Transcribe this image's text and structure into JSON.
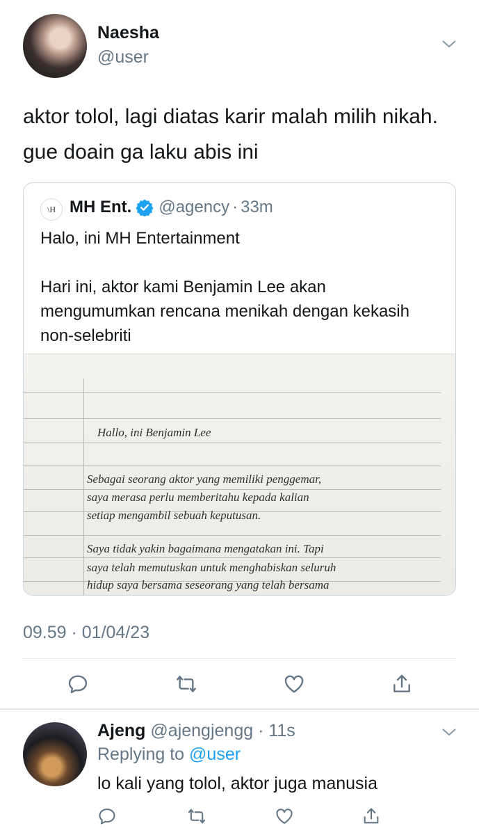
{
  "tweet": {
    "author_name": "Naesha",
    "author_handle": "@user",
    "text": "aktor tolol, lagi diatas karir malah milih nikah. gue doain ga laku abis ini",
    "timestamp": "09.59 · 01/04/23"
  },
  "quote": {
    "logo_text": "\\H",
    "author_name": "MH Ent.",
    "author_handle": "@agency",
    "separator": "·",
    "time": "33m",
    "body": "Halo, ini MH Entertainment\n\nHari ini, aktor kami Benjamin Lee akan mengumumkan rencana menikah dengan kekasih non-selebriti",
    "letter_lines": [
      "Hallo, ini Benjamin Lee",
      "Sebagai seorang aktor yang memiliki penggemar,",
      "saya merasa perlu memberitahu kepada kalian",
      "setiap mengambil sebuah keputusan.",
      "Saya tidak yakin bagaimana mengatakan ini. Tapi",
      "saya telah memutuskan untuk menghabiskan seluruh",
      "hidup saya bersama seseorang yang telah bersama"
    ]
  },
  "actions": [
    "reply-icon",
    "retweet-icon",
    "like-icon",
    "share-icon"
  ],
  "reply": {
    "author_name": "Ajeng",
    "author_handle": "@ajengjengg",
    "separator": "·",
    "time": "11s",
    "replying_label": "Replying to",
    "replying_handle": "@user",
    "text": "lo kali yang tolol, aktor juga manusia"
  },
  "colors": {
    "text": "#14171a",
    "muted": "#657786",
    "link": "#1da1f2",
    "verified": "#1da1f2",
    "border": "#ccd6dd"
  }
}
